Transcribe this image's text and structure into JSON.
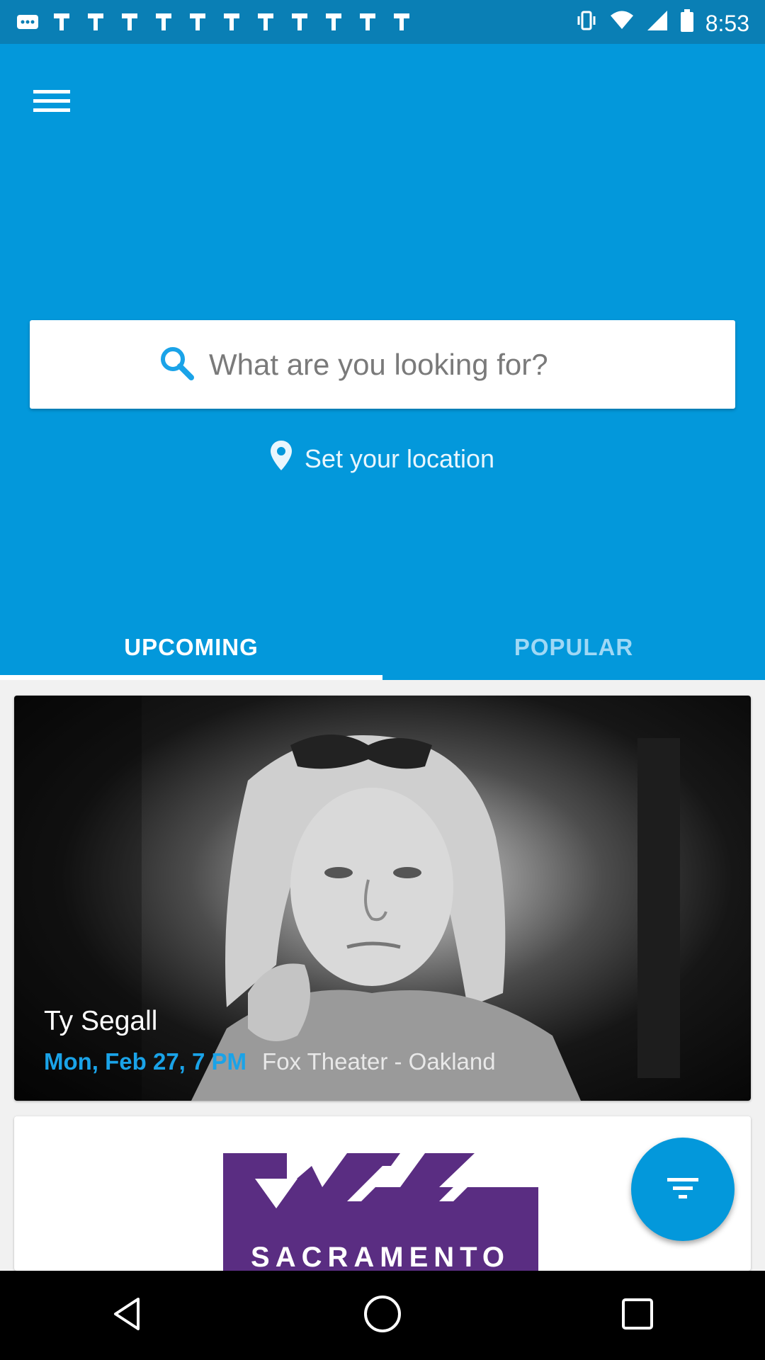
{
  "status_bar": {
    "time": "8:53",
    "notification_icons": [
      "more-icon",
      "photo-icon",
      "photo-icon",
      "photo-icon",
      "photo-icon",
      "photo-icon",
      "photo-icon",
      "photo-icon",
      "photo-icon",
      "photo-icon",
      "photo-icon",
      "photo-icon"
    ],
    "right_icons": [
      "vibrate-icon",
      "wifi-icon",
      "signal-icon",
      "battery-icon"
    ]
  },
  "header": {
    "menu_icon": "menu-icon",
    "search": {
      "placeholder": "What are you looking for?",
      "icon": "search-icon"
    },
    "location": {
      "label": "Set your location",
      "icon": "location-pin-icon"
    }
  },
  "tabs": [
    {
      "label": "UPCOMING",
      "active": true
    },
    {
      "label": "POPULAR",
      "active": false
    }
  ],
  "events": [
    {
      "title": "Ty Segall",
      "date": "Mon, Feb 27, 7 PM",
      "venue": "Fox Theater - Oakland"
    },
    {
      "title": "",
      "logo_text": "SACRAMENTO"
    }
  ],
  "fab": {
    "icon": "filter-icon"
  },
  "colors": {
    "primary": "#0398db",
    "status_bar": "#0a7fb5",
    "accent_date": "#1aa3e8",
    "logo_purple": "#5a2d82"
  },
  "nav_bar": [
    "back-icon",
    "home-icon",
    "recents-icon"
  ]
}
